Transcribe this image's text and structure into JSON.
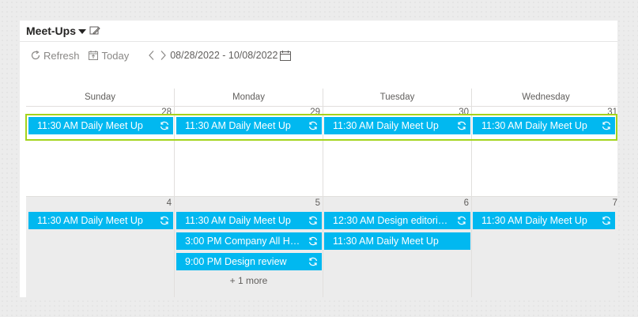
{
  "visual": {
    "title": "Meet-Ups"
  },
  "toolbar": {
    "refresh_label": "Refresh",
    "today_label": "Today",
    "date_range": "08/28/2022 - 10/08/2022"
  },
  "calendar": {
    "day_headers": [
      "Sunday",
      "Monday",
      "Tuesday",
      "Wednesday"
    ],
    "week1": {
      "days": [
        "28",
        "29",
        "30",
        "31"
      ],
      "events": [
        {
          "time": "11:30 AM",
          "title": "Daily Meet Up"
        },
        {
          "time": "11:30 AM",
          "title": "Daily Meet Up"
        },
        {
          "time": "11:30 AM",
          "title": "Daily Meet Up"
        },
        {
          "time": "11:30 AM",
          "title": "Daily Meet Up"
        }
      ]
    },
    "week2": {
      "days": [
        "4",
        "5",
        "6",
        "7"
      ],
      "sunday_events": [
        {
          "time": "11:30 AM",
          "title": "Daily Meet Up"
        }
      ],
      "monday_events": [
        {
          "time": "11:30 AM",
          "title": "Daily Meet Up"
        },
        {
          "time": "3:00 PM",
          "title": "Company All Han..."
        },
        {
          "time": "9:00 PM",
          "title": "Design review"
        }
      ],
      "monday_more": "+ 1 more",
      "tuesday_events": [
        {
          "time": "12:30 AM",
          "title": "Design editorial ..."
        },
        {
          "time": "11:30 AM",
          "title": "Daily Meet Up"
        }
      ],
      "wednesday_events": [
        {
          "time": "11:30 AM",
          "title": "Daily Meet Up"
        }
      ]
    }
  },
  "colors": {
    "event": "#01b8f0",
    "highlight": "#a4d41b",
    "out_of_month": "#ececec"
  }
}
